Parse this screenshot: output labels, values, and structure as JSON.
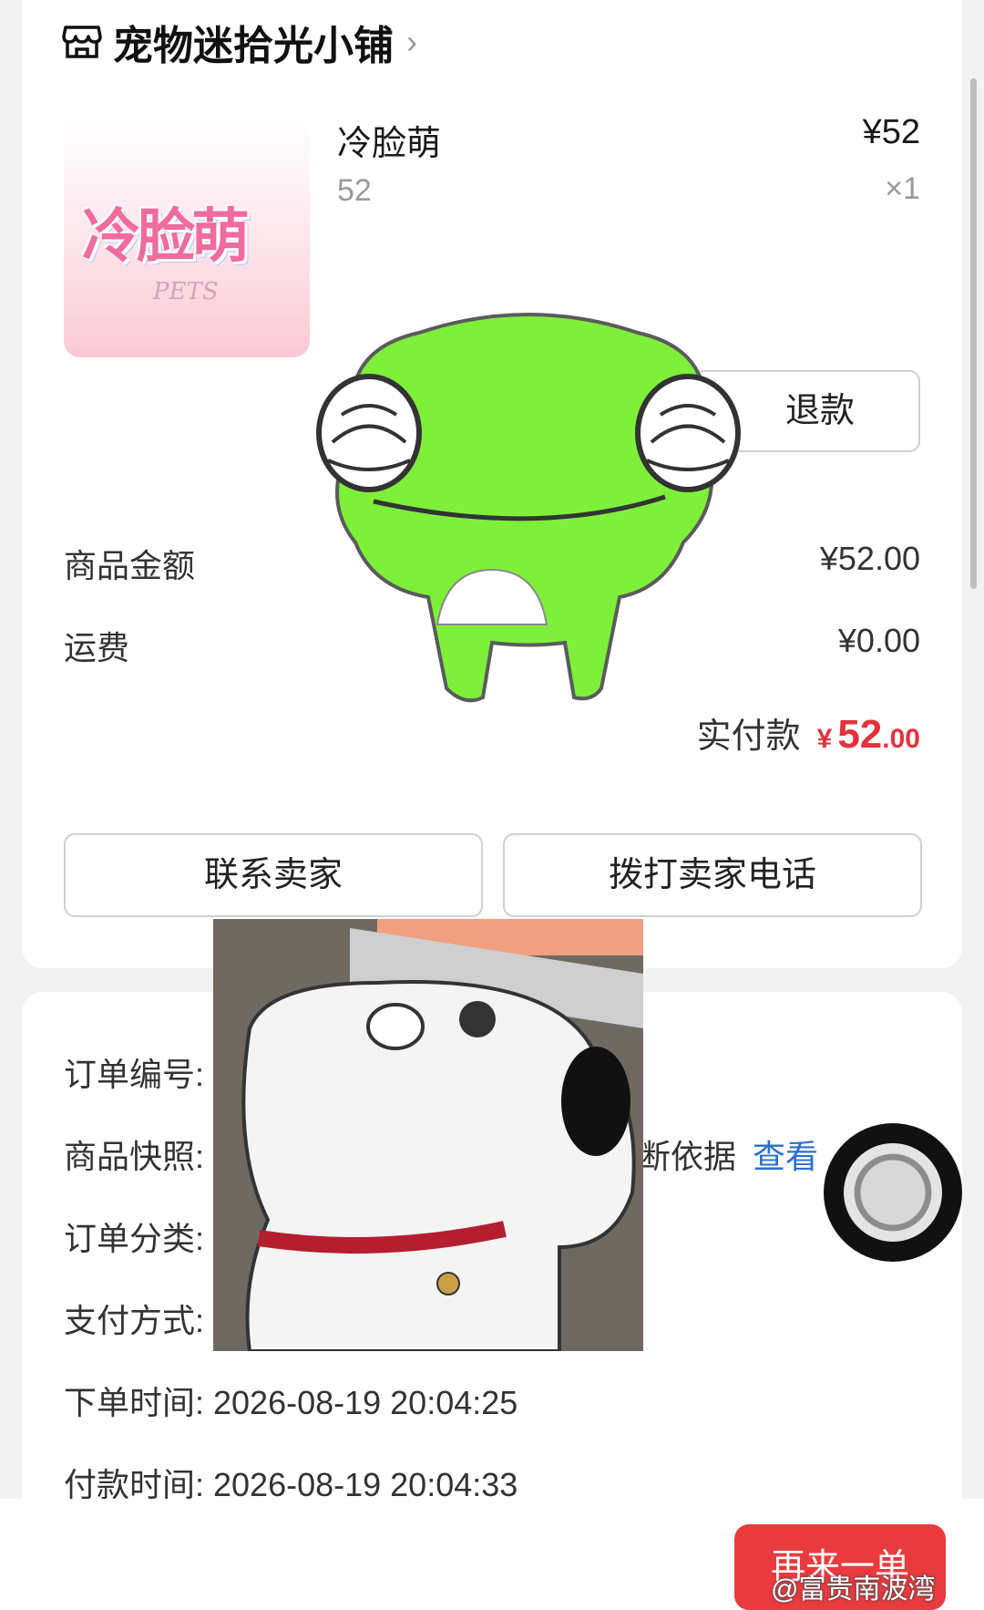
{
  "shop": {
    "name": "宠物迷拾光小铺",
    "chevron": "›"
  },
  "product": {
    "name": "冷脸萌",
    "spec": "52",
    "price": "¥52",
    "qty": "×1",
    "thumb_title": "冷脸萌",
    "thumb_sub": "PETS"
  },
  "refund_label": "退款",
  "summary": {
    "goods_label": "商品金额",
    "goods_value": "¥52.00",
    "shipping_label": "运费",
    "shipping_value": "¥0.00",
    "paid_label": "实付款",
    "paid_yen": "¥",
    "paid_int": "52",
    "paid_dec": ".00"
  },
  "actions": {
    "contact_seller": "联系卖家",
    "call_seller": "拨打卖家电话"
  },
  "order_info": {
    "order_no_label": "订单编号:",
    "snapshot_label": "商品快照:",
    "snapshot_partial": "断依据",
    "snapshot_link": "查看",
    "category_label": "订单分类:",
    "payment_label": "支付方式:",
    "order_time": "下单时间: 2026-08-19 20:04:25",
    "pay_time": "付款时间: 2026-08-19 20:04:33"
  },
  "reorder_label": "再来一单",
  "watermark": "@富贵南波湾",
  "colors": {
    "accent_red": "#e93a3e",
    "link_blue": "#2a6fd1",
    "frog_green": "#7ef03a"
  },
  "icons": [
    "shop-icon",
    "chevron-right-icon"
  ]
}
